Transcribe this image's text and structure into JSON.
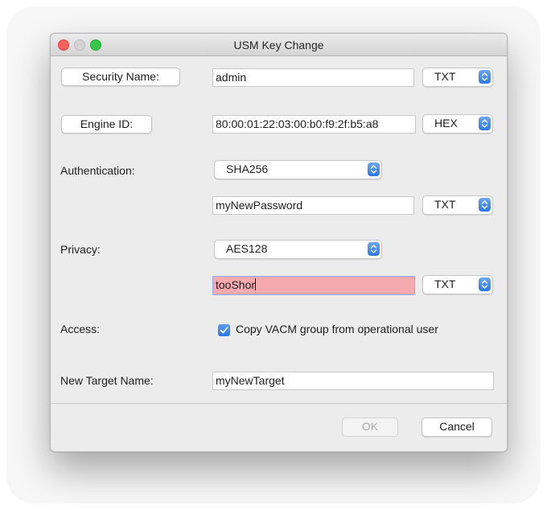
{
  "window": {
    "title": "USM Key Change"
  },
  "security_name": {
    "button_label": "Security Name:",
    "value": "admin",
    "encoding": "TXT"
  },
  "engine_id": {
    "button_label": "Engine ID:",
    "value": "80:00:01:22:03:00:b0:f9:2f:b5:a8",
    "encoding": "HEX"
  },
  "authentication": {
    "label": "Authentication:",
    "protocol": "SHA256",
    "password": "myNewPassword",
    "encoding": "TXT"
  },
  "privacy": {
    "label": "Privacy:",
    "protocol": "AES128",
    "password": "tooShor",
    "encoding": "TXT",
    "password_invalid": true
  },
  "access": {
    "label": "Access:",
    "checkbox_label": "Copy VACM group from operational user",
    "checked": true
  },
  "target": {
    "label": "New Target Name:",
    "value": "myNewTarget"
  },
  "footer": {
    "ok_label": "OK",
    "ok_enabled": false,
    "cancel_label": "Cancel"
  },
  "colors": {
    "accent": "#2a76ea",
    "error_field": "#f6a9ae",
    "close": "#fc605c",
    "zoom": "#34c84a"
  }
}
